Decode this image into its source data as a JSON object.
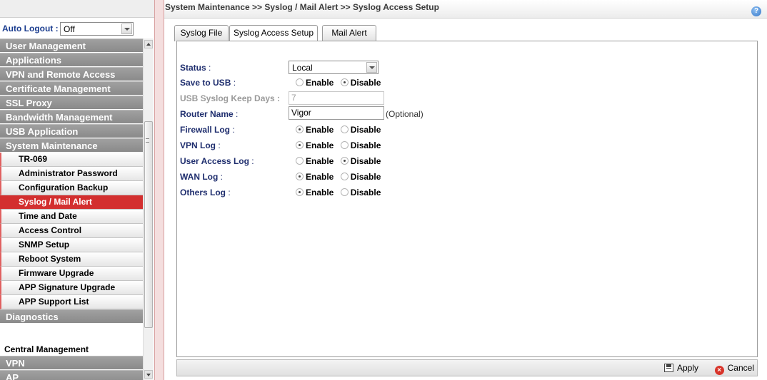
{
  "sidebar": {
    "auto_logout_label": "Auto Logout :",
    "auto_logout_value": "Off",
    "menu": [
      {
        "label": "User Management",
        "kind": "group"
      },
      {
        "label": "Applications",
        "kind": "group"
      },
      {
        "label": "VPN and Remote Access",
        "kind": "group"
      },
      {
        "label": "Certificate Management",
        "kind": "group"
      },
      {
        "label": "SSL Proxy",
        "kind": "group"
      },
      {
        "label": "Bandwidth Management",
        "kind": "group"
      },
      {
        "label": "USB Application",
        "kind": "group"
      },
      {
        "label": "System Maintenance",
        "kind": "group"
      },
      {
        "label": "TR-069",
        "kind": "sub"
      },
      {
        "label": "Administrator Password",
        "kind": "sub"
      },
      {
        "label": "Configuration Backup",
        "kind": "sub"
      },
      {
        "label": "Syslog / Mail Alert",
        "kind": "sub-active"
      },
      {
        "label": "Time and Date",
        "kind": "sub"
      },
      {
        "label": "Access Control",
        "kind": "sub"
      },
      {
        "label": "SNMP Setup",
        "kind": "sub"
      },
      {
        "label": "Reboot System",
        "kind": "sub"
      },
      {
        "label": "Firmware Upgrade",
        "kind": "sub"
      },
      {
        "label": "APP Signature Upgrade",
        "kind": "sub"
      },
      {
        "label": "APP Support List",
        "kind": "sub"
      },
      {
        "label": "Diagnostics",
        "kind": "group"
      },
      {
        "label": "",
        "kind": "gap"
      },
      {
        "label": "Central Management",
        "kind": "plain"
      },
      {
        "label": "VPN",
        "kind": "group"
      },
      {
        "label": "AP",
        "kind": "group"
      }
    ]
  },
  "header": {
    "breadcrumb": "System Maintenance >> Syslog / Mail Alert >> Syslog Access Setup",
    "help_icon": "question-icon"
  },
  "tabs": [
    {
      "label": "Syslog File",
      "active": false
    },
    {
      "label": "Syslog Access Setup",
      "active": true
    },
    {
      "label": "Mail Alert",
      "active": false
    }
  ],
  "form": {
    "status": {
      "label": "Status",
      "value": "Local"
    },
    "save_to_usb": {
      "label": "Save to USB",
      "enable": "Enable",
      "disable": "Disable",
      "selected": "Disable"
    },
    "usb_keep_days": {
      "label": "USB Syslog Keep Days :",
      "value": "7"
    },
    "router_name": {
      "label": "Router Name",
      "value": "Vigor",
      "hint": "(Optional)"
    },
    "firewall_log": {
      "label": "Firewall Log",
      "enable": "Enable",
      "disable": "Disable",
      "selected": "Enable"
    },
    "vpn_log": {
      "label": "VPN Log",
      "enable": "Enable",
      "disable": "Disable",
      "selected": "Enable"
    },
    "user_access_log": {
      "label": "User Access Log",
      "enable": "Enable",
      "disable": "Disable",
      "selected": "Disable"
    },
    "wan_log": {
      "label": "WAN Log",
      "enable": "Enable",
      "disable": "Disable",
      "selected": "Enable"
    },
    "others_log": {
      "label": "Others Log",
      "enable": "Enable",
      "disable": "Disable",
      "selected": "Enable"
    }
  },
  "footer": {
    "apply_label": "Apply",
    "cancel_label": "Cancel"
  }
}
